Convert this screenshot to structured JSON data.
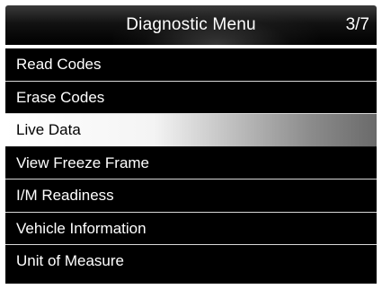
{
  "header": {
    "title": "Diagnostic Menu",
    "page_indicator": "3/7"
  },
  "menu": {
    "items": [
      {
        "label": "Read Codes",
        "selected": false
      },
      {
        "label": "Erase Codes",
        "selected": false
      },
      {
        "label": "Live Data",
        "selected": true
      },
      {
        "label": "View Freeze Frame",
        "selected": false
      },
      {
        "label": "I/M Readiness",
        "selected": false
      },
      {
        "label": "Vehicle Information",
        "selected": false
      },
      {
        "label": "Unit of Measure",
        "selected": false
      }
    ]
  },
  "colors": {
    "background": "#000000",
    "text": "#ffffff",
    "selected_text": "#000000",
    "selected_highlight": "#ffffff",
    "divider": "#d8d8d8"
  }
}
